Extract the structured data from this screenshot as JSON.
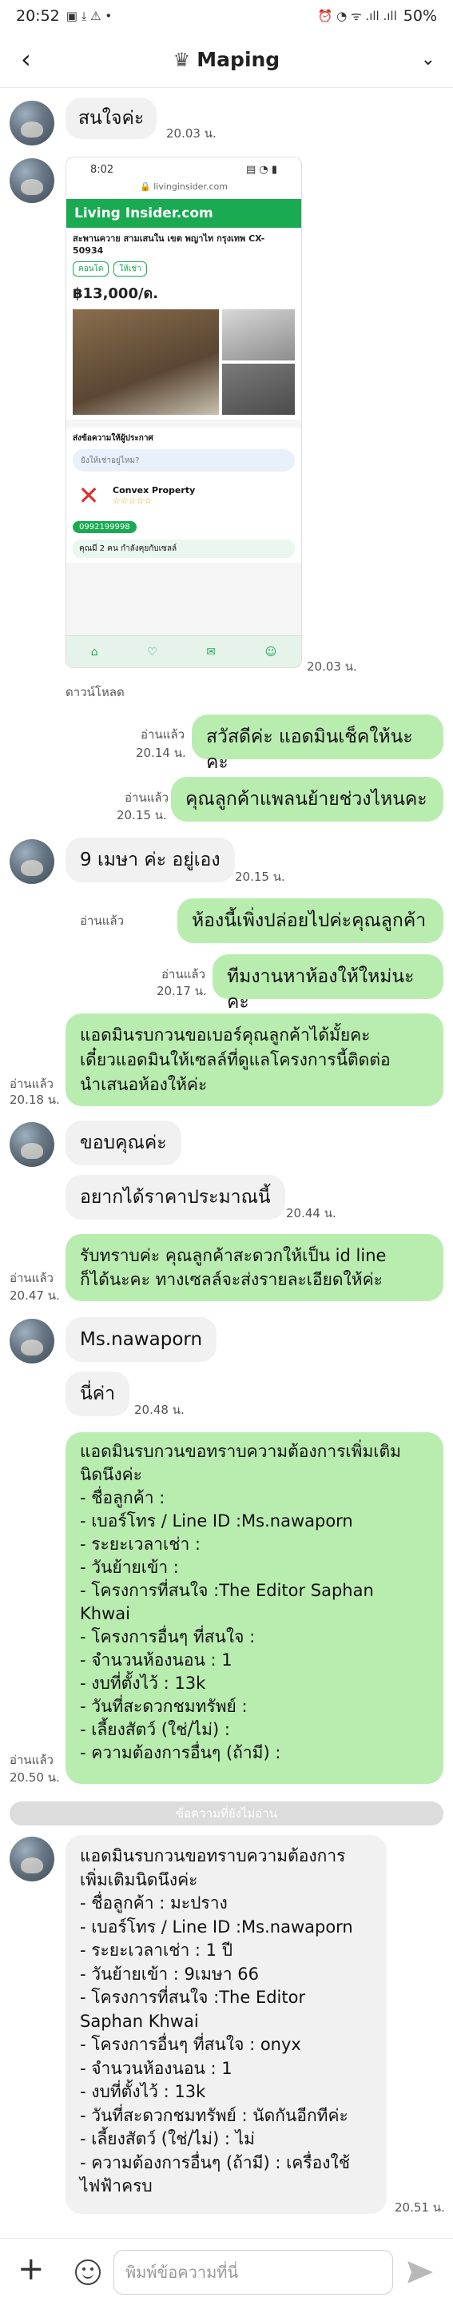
{
  "status_bar": {
    "time": "20:52",
    "battery": "50%",
    "left_icons": "▣ ⤓ ⚠ •",
    "right_icons": "⏰ ◔ ᯤ .ıll .ıll"
  },
  "header": {
    "title": "Maping",
    "crown_icon": "♛",
    "back_icon": "‹",
    "chevron_icon": "⌄"
  },
  "screenshot": {
    "time": "8:02",
    "url": "🔒 livinginsider.com",
    "brand": "Living Insider.com",
    "title": "สะพานควาย สามเสนใน เขต พญาไท กรุงเทพ CX-50934",
    "tags": [
      "คอนโด",
      "ให้เช่า"
    ],
    "price": "฿13,000/ด.",
    "contact_heading": "ส่งข้อความให้ผู้ประกาศ",
    "input_hint": "ยังให้เช่าอยู่ไหม?",
    "agent": "Convex Property",
    "call": "0992199998",
    "banner": "คุณมี 2 คน กำลังคุยกับเซลล์"
  },
  "messages": [
    {
      "text": "สนใจค่ะ",
      "time": "20.03 น."
    },
    {
      "time": "20.03 น.",
      "download": "ดาวน์โหลด"
    },
    {
      "text": "สวัสดีค่ะ แอดมินเช็คให้นะคะ",
      "time": "20.14 น.",
      "read": "อ่านแล้ว"
    },
    {
      "text": "คุณลูกค้าแพลนย้ายช่วงไหนคะ",
      "time": "20.15 น.",
      "read": "อ่านแล้ว"
    },
    {
      "text": "9 เมษา ค่ะ อยู่เอง",
      "time": "20.15 น."
    },
    {
      "text": "ห้องนี้เพิ่งปล่อยไปค่ะคุณลูกค้า",
      "read": "อ่านแล้ว"
    },
    {
      "text": "ทีมงานหาห้องให้ใหม่นะคะ",
      "time": "20.17 น.",
      "read": "อ่านแล้ว"
    },
    {
      "text": "แอดมินรบกวนขอเบอร์คุณลูกค้าได้มั้ยคะ\nเดี๋ยวแอดมินให้เซลล์ที่ดูแลโครงการนี้ติดต่อ\nนำเสนอห้องให้ค่ะ",
      "time": "20.18 น.",
      "read": "อ่านแล้ว"
    },
    {
      "text": "ขอบคุณค่ะ"
    },
    {
      "text": "อยากได้ราคาประมาณนี้",
      "time": "20.44 น."
    },
    {
      "text": "รับทราบค่ะ คุณลูกค้าสะดวกให้เป็น id line\nก็ได้นะคะ ทางเซลล์จะส่งรายละเอียดให้ค่ะ",
      "time": "20.47 น.",
      "read": "อ่านแล้ว"
    },
    {
      "text": "Ms.nawaporn"
    },
    {
      "text": "นี่ค่า",
      "time": "20.48 น."
    },
    {
      "text": "แอดมินรบกวนขอทราบความต้องการเพิ่มเติม\nนิดนึงค่ะ\n- ชื่อลูกค้า :\n- เบอร์โทร / Line ID :Ms.nawaporn\n- ระยะเวลาเช่า :\n- วันย้ายเข้า :\n- โครงการที่สนใจ :The Editor Saphan\nKhwai\n- โครงการอื่นๆ ที่สนใจ :\n- จำนวนห้องนอน : 1\n- งบที่ตั้งไว้ : 13k\n- วันที่สะดวกชมทรัพย์ :\n- เลี้ยงสัตว์ (ใช่/ไม่) :\n- ความต้องการอื่นๆ (ถ้ามี) :",
      "time": "20.50 น.",
      "read": "อ่านแล้ว"
    },
    {
      "text": "แอดมินรบกวนขอทราบความต้องการ\nเพิ่มเติมนิดนึงค่ะ\n- ชื่อลูกค้า : มะปราง\n- เบอร์โทร / Line ID :Ms.nawaporn\n- ระยะเวลาเช่า : 1 ปี\n- วันย้ายเข้า : 9เมษา 66\n- โครงการที่สนใจ :The Editor\nSaphan Khwai\n- โครงการอื่นๆ ที่สนใจ : onyx\n- จำนวนห้องนอน : 1\n- งบที่ตั้งไว้ : 13k\n- วันที่สะดวกชมทรัพย์ : นัดกันอีกทีค่ะ\n- เลี้ยงสัตว์ (ใช่/ไม่) : ไม่\n- ความต้องการอื่นๆ (ถ้ามี) : เครื่องใช้\nไฟฟ้าครบ",
      "time": "20.51 น."
    }
  ],
  "divider": "ข้อความที่ยังไม่อ่าน",
  "input": {
    "placeholder": "พิมพ์ข้อความที่นี่"
  },
  "colors": {
    "outgoing": "#b9edaf",
    "incoming": "#f1f1f1",
    "accent": "#1aaa52"
  }
}
